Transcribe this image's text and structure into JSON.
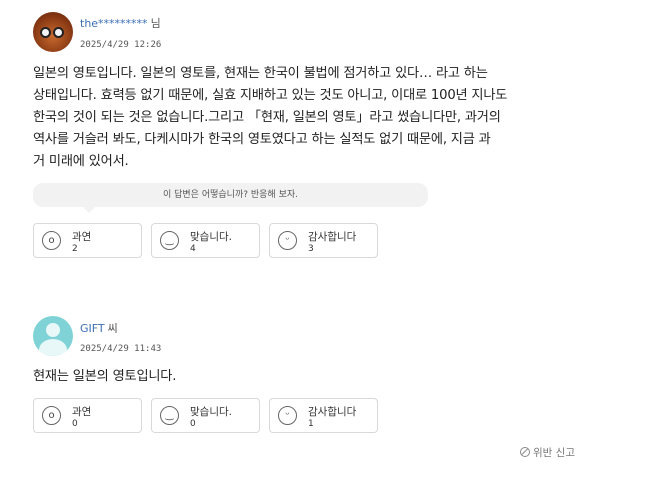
{
  "answers": [
    {
      "username": "the*********",
      "suffix": "님",
      "date": "2025/4/29 12:26",
      "lines": [
        "일본의 영토입니다. 일본의 영토를, 현재는 한국이 불법에 점거하고 있다… 라고 하는",
        "상태입니다. 효력등 없기 때문에, 실효 지배하고 있는 것도 아니고, 이대로 100년 지나도",
        "한국의 것이 되는 것은 없습니다.그리고 「현재, 일본의 영토」라고 썼습니다만, 과거의",
        "역사를 거슬러 봐도, 다케시마가 한국의 영토였다고 하는 실적도 없기 때문에, 지금 과",
        "거 미래에 있어서."
      ],
      "feedback_prompt": "이 답변은 어떻습니까? 반응해 보자.",
      "reactions": [
        {
          "label": "과연",
          "count": "2",
          "icon": "surprised-face-icon"
        },
        {
          "label": "맞습니다.",
          "count": "4",
          "icon": "smile-face-icon"
        },
        {
          "label": "감사합니다",
          "count": "3",
          "icon": "grin-face-icon"
        }
      ]
    },
    {
      "username": "GIFT",
      "suffix": "씨",
      "date": "2025/4/29 11:43",
      "lines": [
        "현재는 일본의 영토입니다."
      ],
      "reactions": [
        {
          "label": "과연",
          "count": "0",
          "icon": "surprised-face-icon"
        },
        {
          "label": "맞습니다.",
          "count": "0",
          "icon": "smile-face-icon"
        },
        {
          "label": "감사합니다",
          "count": "1",
          "icon": "grin-face-icon"
        }
      ]
    }
  ],
  "report_label": "위반 신고",
  "colors": {
    "username": "#3b6fb4",
    "border": "#d9d9d9",
    "bubble": "#f2f2f2"
  }
}
